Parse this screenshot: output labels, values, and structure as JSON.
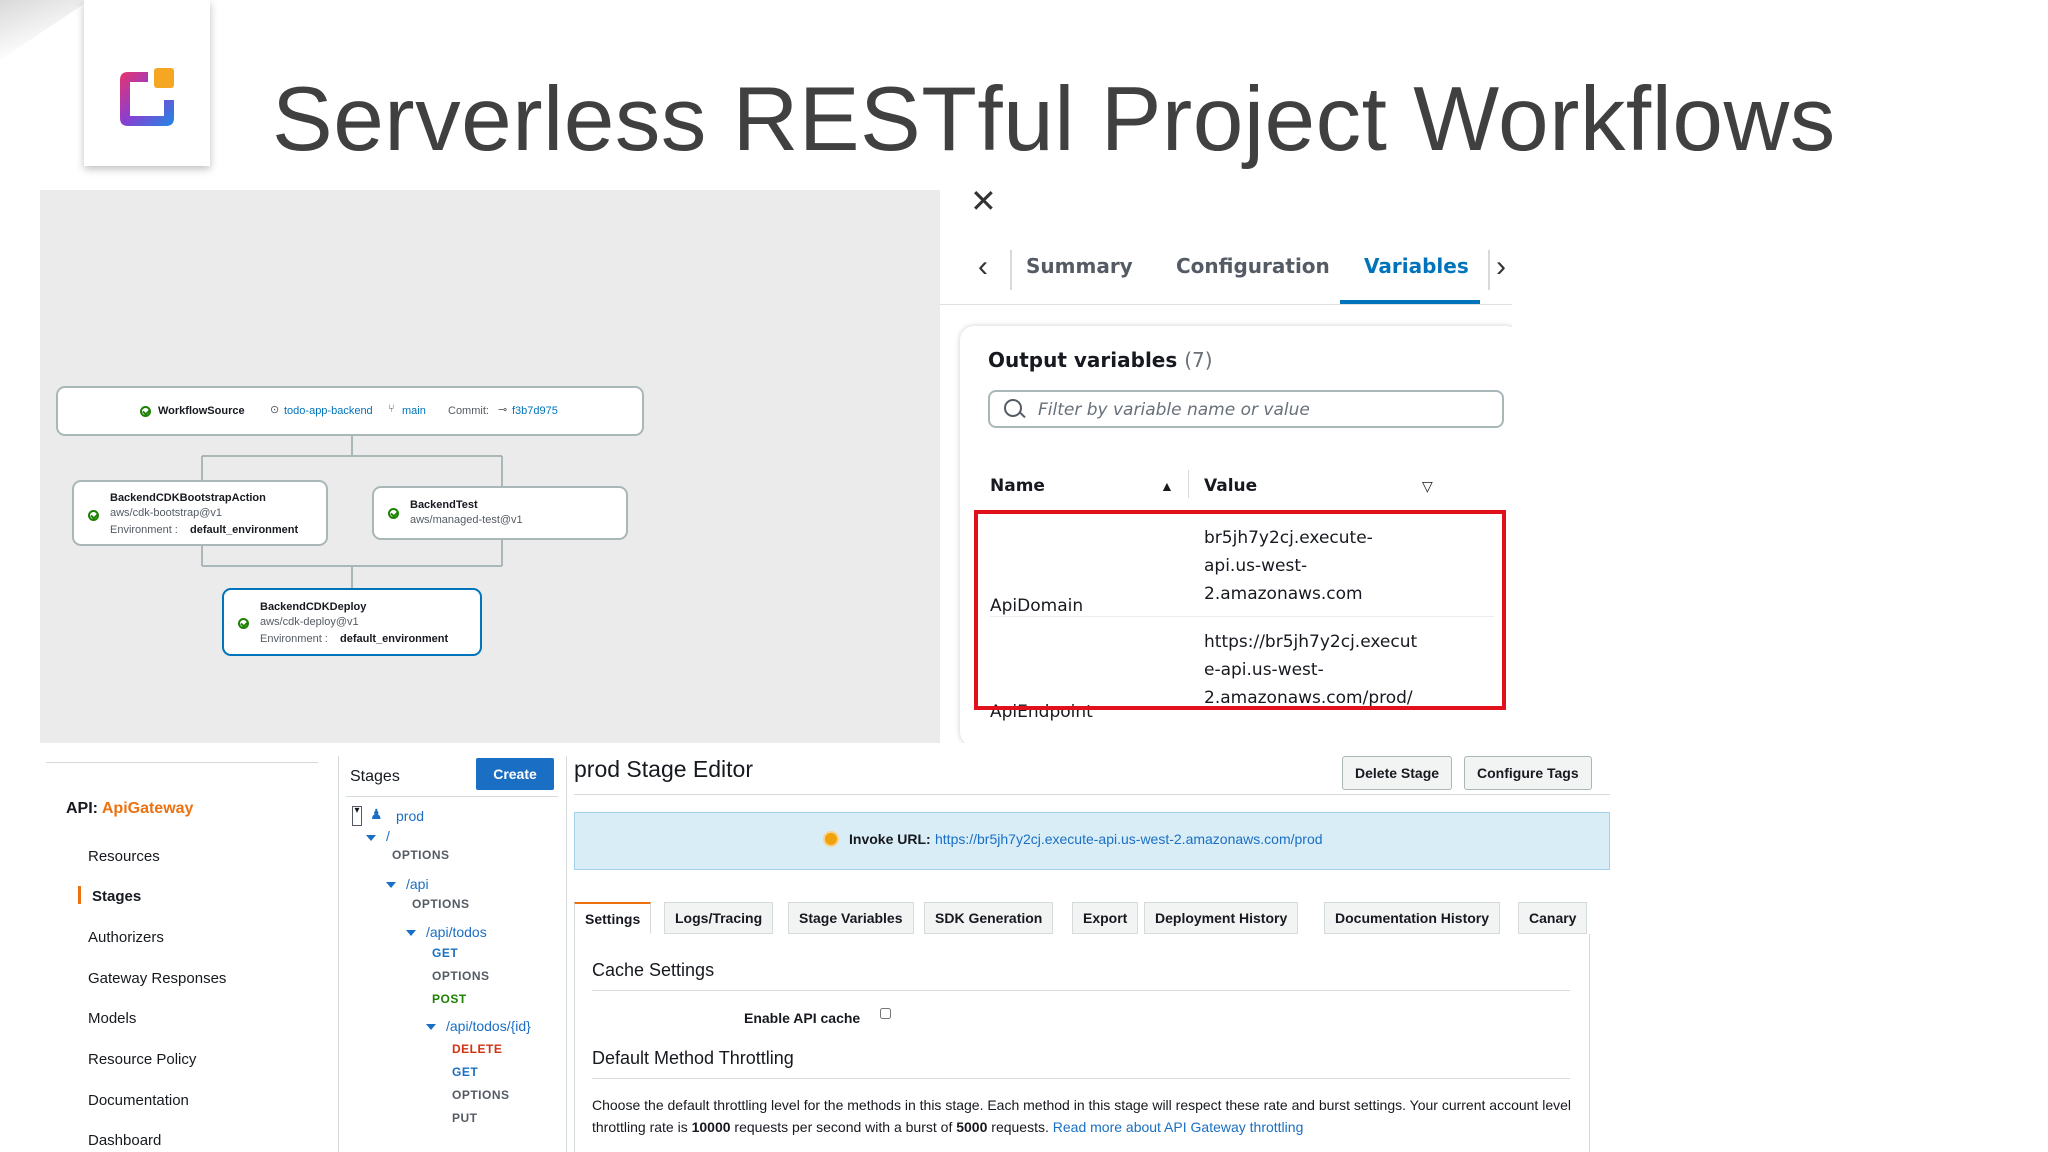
{
  "slide": {
    "title": "Serverless RESTful Project Workflows"
  },
  "workflow": {
    "source": {
      "label": "WorkflowSource",
      "repo": "todo-app-backend",
      "branch": "main",
      "commit_label": "Commit:",
      "commit": "f3b7d975"
    },
    "bootstrap": {
      "name": "BackendCDKBootstrapAction",
      "action": "aws/cdk-bootstrap@v1",
      "env_label": "Environment :",
      "env": "default_environment"
    },
    "test": {
      "name": "BackendTest",
      "action": "aws/managed-test@v1"
    },
    "deploy": {
      "name": "BackendCDKDeploy",
      "action": "aws/cdk-deploy@v1",
      "env_label": "Environment :",
      "env": "default_environment"
    }
  },
  "variables_panel": {
    "tabs": [
      "Summary",
      "Configuration",
      "Variables"
    ],
    "active_tab": "Variables",
    "output_title": "Output variables",
    "output_count": "(7)",
    "filter_placeholder": "Filter by variable name or value",
    "columns": {
      "name": "Name",
      "value": "Value"
    },
    "rows": [
      {
        "name": "ApiDomain",
        "value_lines": [
          "br5jh7y2cj.execute-",
          "api.us-west-",
          "2.amazonaws.com"
        ]
      },
      {
        "name": "ApiEndpoint",
        "value_lines": [
          "https://br5jh7y2cj.execut",
          "e-api.us-west-",
          "2.amazonaws.com/prod/"
        ]
      }
    ],
    "highlight_color": "#e0111b"
  },
  "apigateway": {
    "api_label": "API:",
    "api_name": "ApiGateway",
    "nav": [
      "Resources",
      "Stages",
      "Authorizers",
      "Gateway Responses",
      "Models",
      "Resource Policy",
      "Documentation",
      "Dashboard"
    ],
    "active_nav": "Stages",
    "stages_title": "Stages",
    "create_label": "Create",
    "tree": {
      "stage": "prod",
      "root": "/",
      "root_options": "OPTIONS",
      "api": "/api",
      "api_options": "OPTIONS",
      "todos": "/api/todos",
      "todos_methods": [
        "GET",
        "OPTIONS",
        "POST"
      ],
      "todo_id": "/api/todos/{id}",
      "todo_id_methods": [
        "DELETE",
        "GET",
        "OPTIONS",
        "PUT"
      ]
    },
    "editor_title": "prod Stage Editor",
    "delete_stage": "Delete Stage",
    "configure_tags": "Configure Tags",
    "invoke_label": "Invoke URL:",
    "invoke_url": "https://br5jh7y2cj.execute-api.us-west-2.amazonaws.com/prod",
    "stage_tabs": [
      "Settings",
      "Logs/Tracing",
      "Stage Variables",
      "SDK Generation",
      "Export",
      "Deployment History",
      "Documentation History",
      "Canary"
    ],
    "active_stage_tab": "Settings",
    "cache_settings_title": "Cache Settings",
    "enable_cache_label": "Enable API cache",
    "throttling_title": "Default Method Throttling",
    "throttle_text_1": "Choose the default throttling level for the methods in this stage. Each method in this stage will respect these rate and burst settings. Your current account level throttling rate is ",
    "throttle_rate": "10000",
    "throttle_text_2": " requests per second with a burst of ",
    "throttle_burst": "5000",
    "throttle_text_3": " requests. ",
    "throttle_link": "Read more about API Gateway throttling"
  }
}
